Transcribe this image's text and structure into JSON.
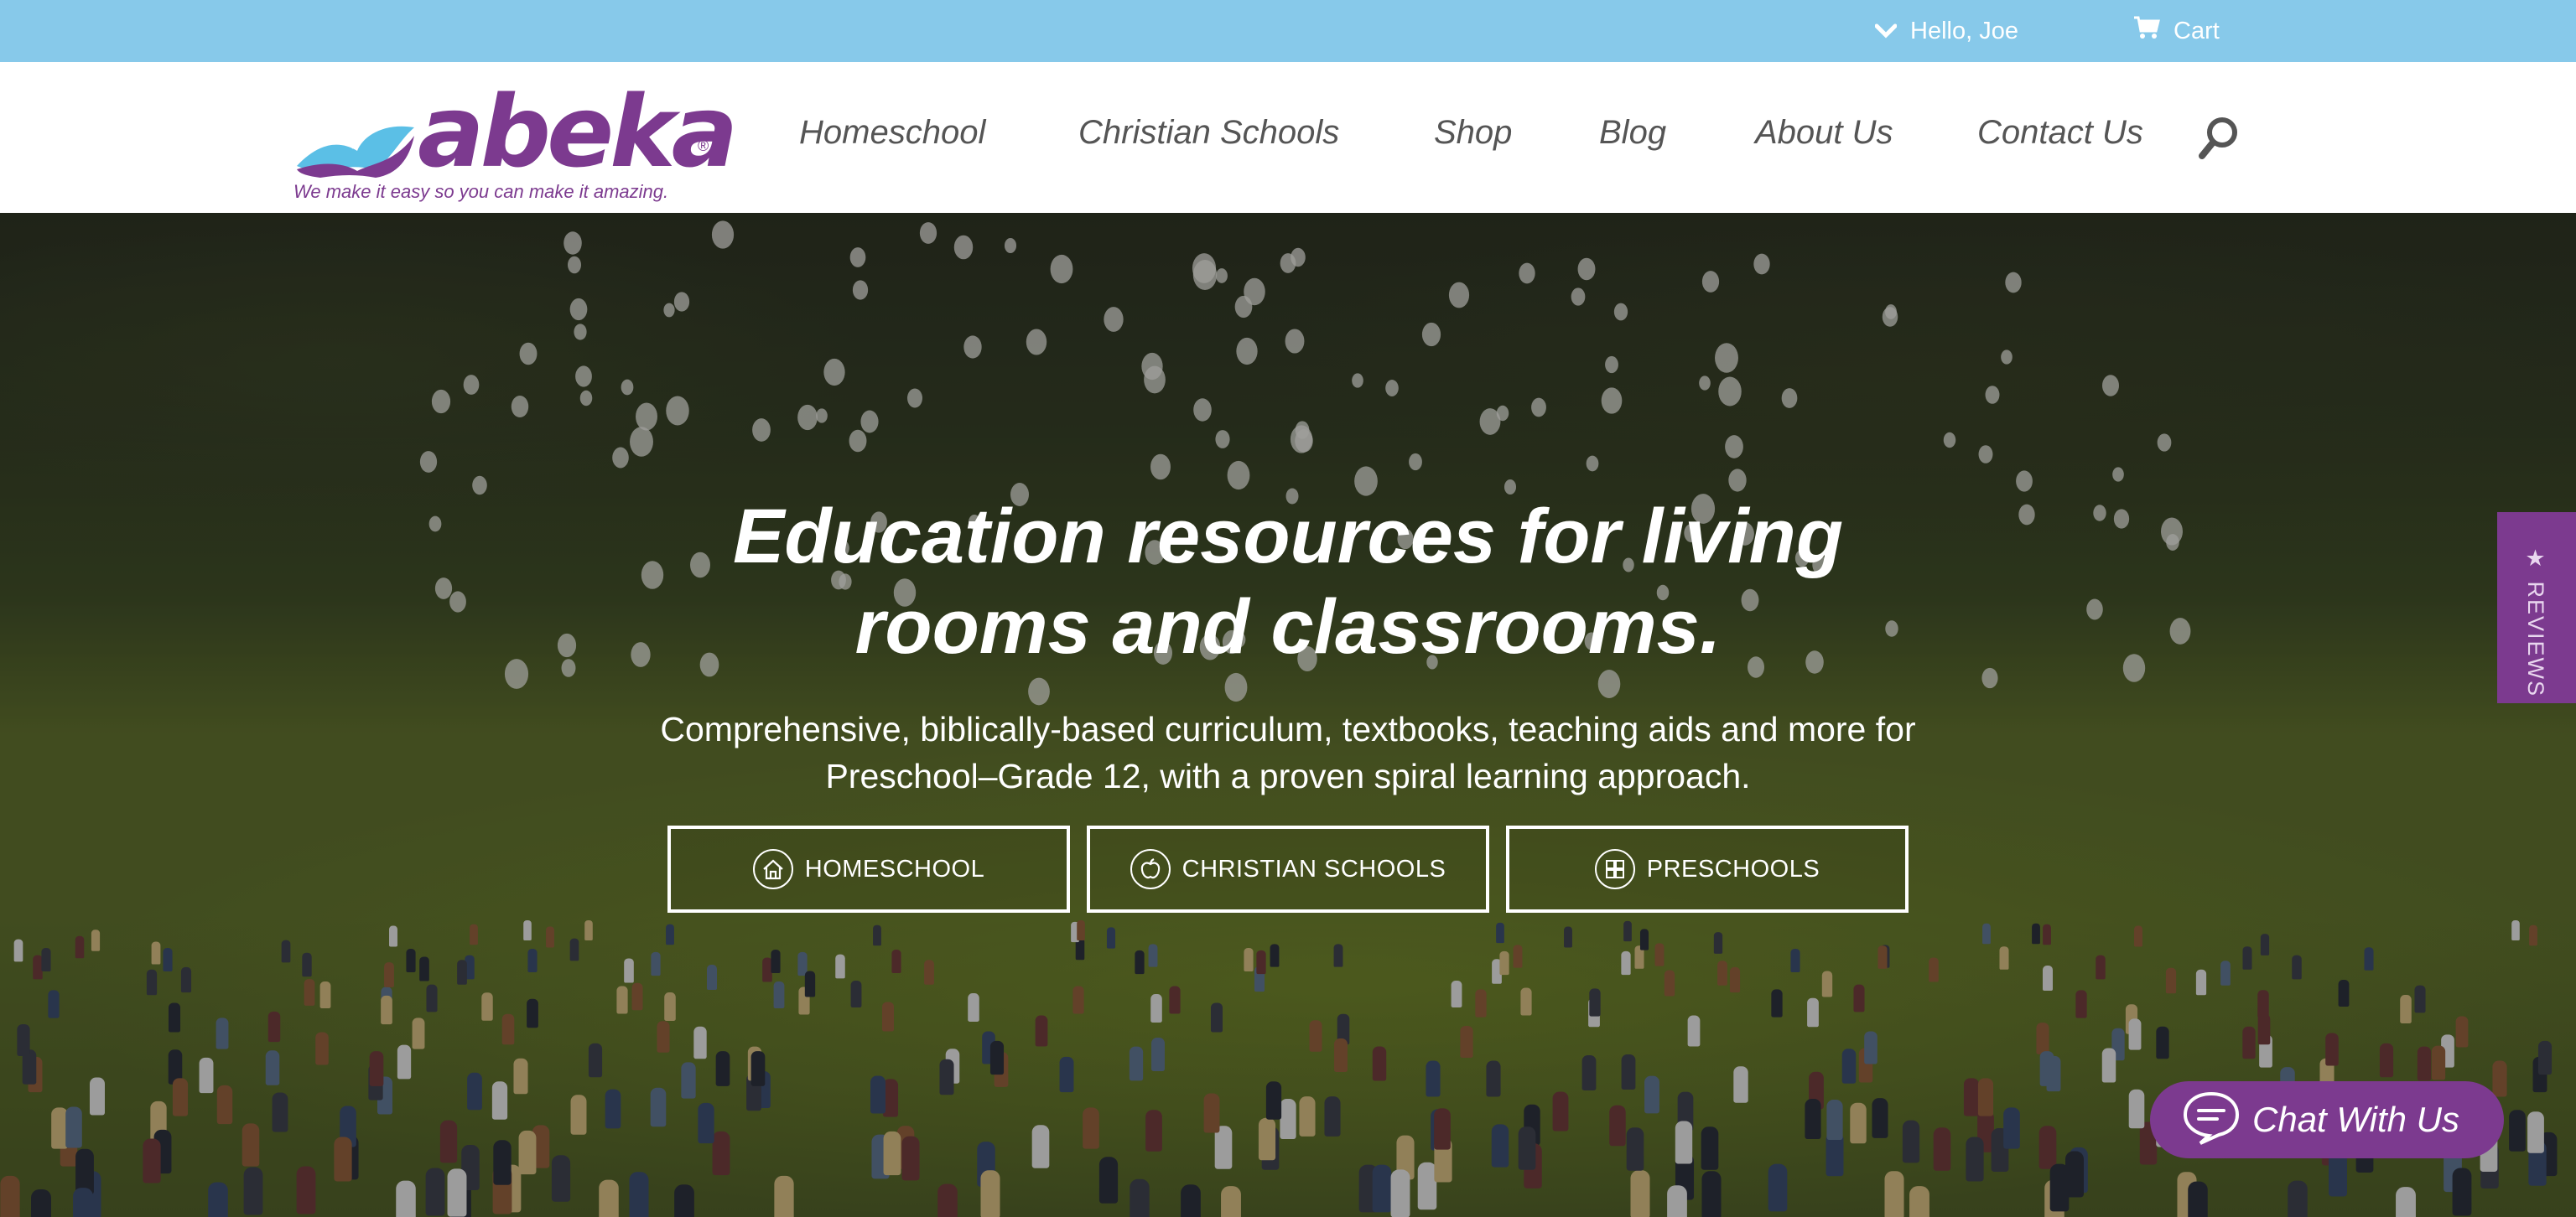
{
  "topbar": {
    "account_label": "Hello, Joe",
    "account_icon": "chevron-down-icon",
    "cart_label": "Cart",
    "cart_icon": "cart-icon",
    "background": "#87c9ea"
  },
  "brand": {
    "wordmark": "abeka",
    "registered_mark": "®",
    "tagline": "We make it easy so you can make it amazing.",
    "color": "#7c3a8f",
    "book_color": "#5bbfe6"
  },
  "nav": {
    "items": [
      {
        "label": "Homeschool"
      },
      {
        "label": "Christian Schools"
      },
      {
        "label": "Shop"
      },
      {
        "label": "Blog"
      },
      {
        "label": "About Us"
      },
      {
        "label": "Contact Us"
      }
    ],
    "search_icon": "search-icon"
  },
  "hero": {
    "title_line1": "Education resources for living",
    "title_line2": "rooms and classrooms.",
    "subtitle_line1": "Comprehensive, biblically-based curriculum, textbooks, teaching aids and more for",
    "subtitle_line2": "Preschool–Grade 12, with a proven spiral learning approach.",
    "ctas": [
      {
        "label": "HOMESCHOOL",
        "icon": "house-icon"
      },
      {
        "label": "CHRISTIAN SCHOOLS",
        "icon": "apple-icon"
      },
      {
        "label": "PRESCHOOLS",
        "icon": "blocks-icon"
      }
    ]
  },
  "reviews_tab": {
    "label": "★ REVIEWS"
  },
  "chat": {
    "label": "Chat With Us",
    "icon": "chat-bubble-icon",
    "color": "#7c3a8f"
  }
}
